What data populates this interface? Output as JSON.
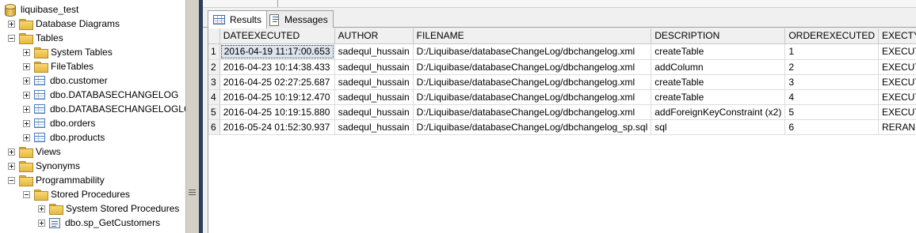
{
  "tree": {
    "items": [
      {
        "label": "liquibase_test",
        "icon": "database-icon",
        "expander": "none",
        "indent": 0
      },
      {
        "label": "Database Diagrams",
        "icon": "folder-icon",
        "expander": "plus",
        "indent": 1
      },
      {
        "label": "Tables",
        "icon": "folder-icon",
        "expander": "minus",
        "indent": 1
      },
      {
        "label": "System Tables",
        "icon": "folder-icon",
        "expander": "plus",
        "indent": 2
      },
      {
        "label": "FileTables",
        "icon": "folder-icon",
        "expander": "plus",
        "indent": 2
      },
      {
        "label": "dbo.customer",
        "icon": "table-icon",
        "expander": "plus",
        "indent": 2
      },
      {
        "label": "dbo.DATABASECHANGELOG",
        "icon": "table-icon",
        "expander": "plus",
        "indent": 2
      },
      {
        "label": "dbo.DATABASECHANGELOGLO",
        "icon": "table-icon",
        "expander": "plus",
        "indent": 2
      },
      {
        "label": "dbo.orders",
        "icon": "table-icon",
        "expander": "plus",
        "indent": 2
      },
      {
        "label": "dbo.products",
        "icon": "table-icon",
        "expander": "plus",
        "indent": 2
      },
      {
        "label": "Views",
        "icon": "folder-icon",
        "expander": "plus",
        "indent": 1
      },
      {
        "label": "Synonyms",
        "icon": "folder-icon",
        "expander": "plus",
        "indent": 1
      },
      {
        "label": "Programmability",
        "icon": "folder-icon",
        "expander": "minus",
        "indent": 1
      },
      {
        "label": "Stored Procedures",
        "icon": "folder-icon",
        "expander": "minus",
        "indent": 2
      },
      {
        "label": "System Stored Procedures",
        "icon": "folder-icon",
        "expander": "plus",
        "indent": 3
      },
      {
        "label": "dbo.sp_GetCustomers",
        "icon": "stored-procedure-icon",
        "expander": "plus",
        "indent": 3
      }
    ]
  },
  "tabs": {
    "results": "Results",
    "messages": "Messages"
  },
  "grid": {
    "columns": [
      "DATEEXECUTED",
      "AUTHOR",
      "FILENAME",
      "DESCRIPTION",
      "ORDEREXECUTED",
      "EXECTYPE"
    ],
    "rows": [
      {
        "num": "1",
        "cells": [
          "2016-04-19 11:17:00.653",
          "sadequl_hussain",
          "D:/Liquibase/databaseChangeLog/dbchangelog.xml",
          "createTable",
          "1",
          "EXECUTED"
        ]
      },
      {
        "num": "2",
        "cells": [
          "2016-04-23 10:14:38.433",
          "sadequl_hussain",
          "D:/Liquibase/databaseChangeLog/dbchangelog.xml",
          "addColumn",
          "2",
          "EXECUTED"
        ]
      },
      {
        "num": "3",
        "cells": [
          "2016-04-25 02:27:25.687",
          "sadequl_hussain",
          "D:/Liquibase/databaseChangeLog/dbchangelog.xml",
          "createTable",
          "3",
          "EXECUTED"
        ]
      },
      {
        "num": "4",
        "cells": [
          "2016-04-25 10:19:12.470",
          "sadequl_hussain",
          "D:/Liquibase/databaseChangeLog/dbchangelog.xml",
          "createTable",
          "4",
          "EXECUTED"
        ]
      },
      {
        "num": "5",
        "cells": [
          "2016-04-25 10:19:15.880",
          "sadequl_hussain",
          "D:/Liquibase/databaseChangeLog/dbchangelog.xml",
          "addForeignKeyConstraint (x2)",
          "5",
          "EXECUTED"
        ]
      },
      {
        "num": "6",
        "cells": [
          "2016-05-24 01:52:30.937",
          "sadequl_hussain",
          "D:/Liquibase/databaseChangeLog/dbchangelog_sp.sql",
          "sql",
          "6",
          "RERAN"
        ]
      }
    ]
  },
  "colors": {
    "folder": "#e7b93f",
    "pane_edge": "#2b3f5c",
    "selected_cell": "#dde4ee"
  }
}
